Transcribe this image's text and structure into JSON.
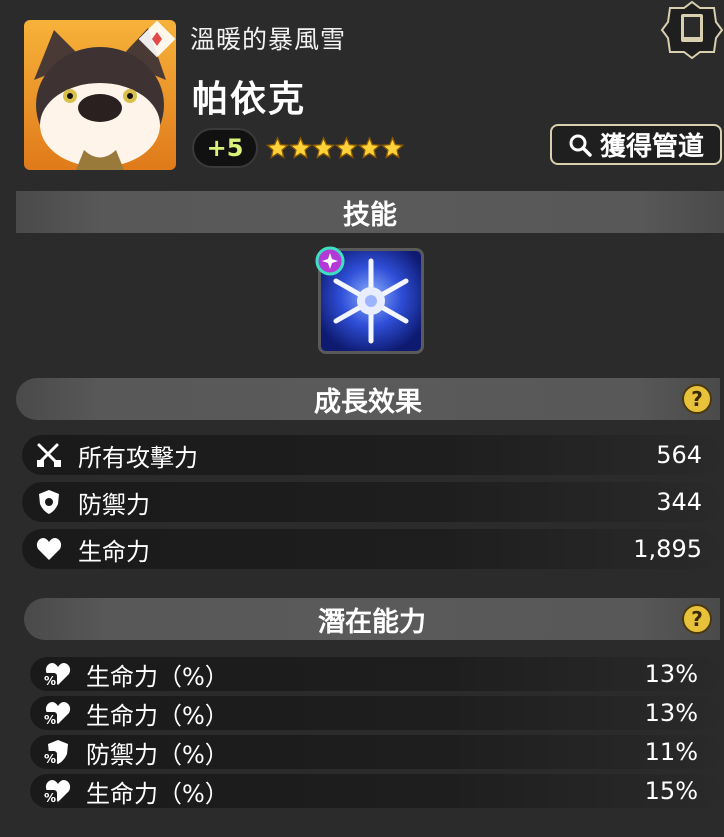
{
  "header": {
    "subtitle": "溫暖的暴風雪",
    "name": "帕依克",
    "plus_level": "+5",
    "stars": 6,
    "source_button_label": "獲得管道",
    "icons": {
      "book": "book-icon",
      "search": "search-icon"
    }
  },
  "sections": {
    "skill_title": "技能",
    "growth_title": "成長效果",
    "potential_title": "潛在能力",
    "help_symbol": "?"
  },
  "growth_stats": [
    {
      "icon": "crossed-swords-icon",
      "label": "所有攻擊力",
      "value": "564"
    },
    {
      "icon": "shield-icon",
      "label": "防禦力",
      "value": "344"
    },
    {
      "icon": "heart-icon",
      "label": "生命力",
      "value": "1,895"
    }
  ],
  "potential_stats": [
    {
      "icon": "heart-percent-icon",
      "label": "生命力（%）",
      "value": "13%"
    },
    {
      "icon": "heart-percent-icon",
      "label": "生命力（%）",
      "value": "13%"
    },
    {
      "icon": "shield-percent-icon",
      "label": "防禦力（%）",
      "value": "11%"
    },
    {
      "icon": "heart-percent-icon",
      "label": "生命力（%）",
      "value": "15%"
    }
  ],
  "colors": {
    "accent_gold": "#e8c23a",
    "plus_text": "#d9f27a",
    "background": "#2b2b2b"
  }
}
